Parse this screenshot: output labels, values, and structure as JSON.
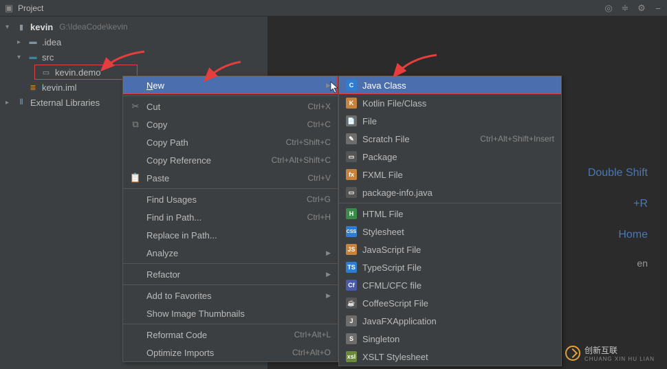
{
  "toolbar": {
    "title": "Project"
  },
  "tree": {
    "root_name": "kevin",
    "root_path": "G:\\IdeaCode\\kevin",
    "idea_folder": ".idea",
    "src_folder": "src",
    "package_name": "kevin.demo",
    "iml_file": "kevin.iml",
    "external_libs": "External Libraries"
  },
  "ctx": {
    "new": "New",
    "cut": "Cut",
    "cut_sc": "Ctrl+X",
    "copy": "Copy",
    "copy_sc": "Ctrl+C",
    "copy_path": "Copy Path",
    "copy_path_sc": "Ctrl+Shift+C",
    "copy_ref": "Copy Reference",
    "copy_ref_sc": "Ctrl+Alt+Shift+C",
    "paste": "Paste",
    "paste_sc": "Ctrl+V",
    "find_usages": "Find Usages",
    "find_usages_sc": "Ctrl+G",
    "find_path": "Find in Path...",
    "find_path_sc": "Ctrl+H",
    "replace_path": "Replace in Path...",
    "analyze": "Analyze",
    "refactor": "Refactor",
    "favorites": "Add to Favorites",
    "thumbnails": "Show Image Thumbnails",
    "reformat": "Reformat Code",
    "reformat_sc": "Ctrl+Alt+L",
    "optimize": "Optimize Imports",
    "optimize_sc": "Ctrl+Alt+O"
  },
  "sub": {
    "java_class": "Java Class",
    "kotlin": "Kotlin File/Class",
    "file": "File",
    "scratch": "Scratch File",
    "scratch_sc": "Ctrl+Alt+Shift+Insert",
    "package": "Package",
    "fxml": "FXML File",
    "pkginfo": "package-info.java",
    "html": "HTML File",
    "stylesheet": "Stylesheet",
    "javascript": "JavaScript File",
    "typescript": "TypeScript File",
    "cfml": "CFML/CFC file",
    "coffee": "CoffeeScript File",
    "javafx": "JavaFXApplication",
    "singleton": "Singleton",
    "xslt": "XSLT Stylesheet"
  },
  "hints": {
    "h1": "Double Shift",
    "h2": "+R",
    "h3": "Home",
    "h4": "en"
  },
  "logo": {
    "cn": "创新互联",
    "en": "CHUANG XIN HU LIAN"
  }
}
